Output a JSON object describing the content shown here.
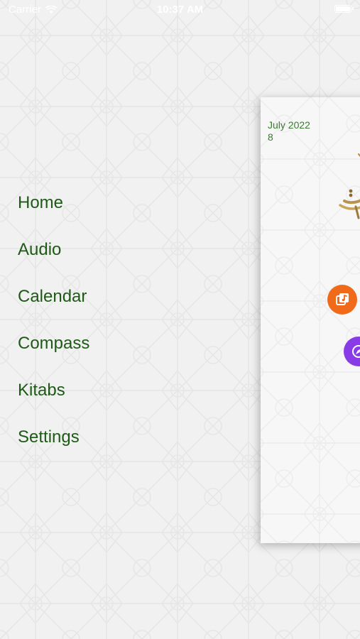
{
  "status_bar": {
    "carrier": "Carrier",
    "time": "10:37 AM"
  },
  "menu": {
    "items": [
      {
        "label": "Home"
      },
      {
        "label": "Audio"
      },
      {
        "label": "Calendar"
      },
      {
        "label": "Compass"
      },
      {
        "label": "Kitabs"
      },
      {
        "label": "Settings"
      }
    ]
  },
  "card": {
    "month_year": "July 2022",
    "day": "8",
    "buttons": [
      {
        "icon": "music-library-icon",
        "color": "#f06a1a"
      },
      {
        "icon": "compass-icon",
        "color": "#8a3be8"
      }
    ]
  },
  "colors": {
    "menu_text": "#1e5a16",
    "date_text": "#3a7a30",
    "background": "#f1f1f1",
    "logo_gold": "#b8944a"
  }
}
